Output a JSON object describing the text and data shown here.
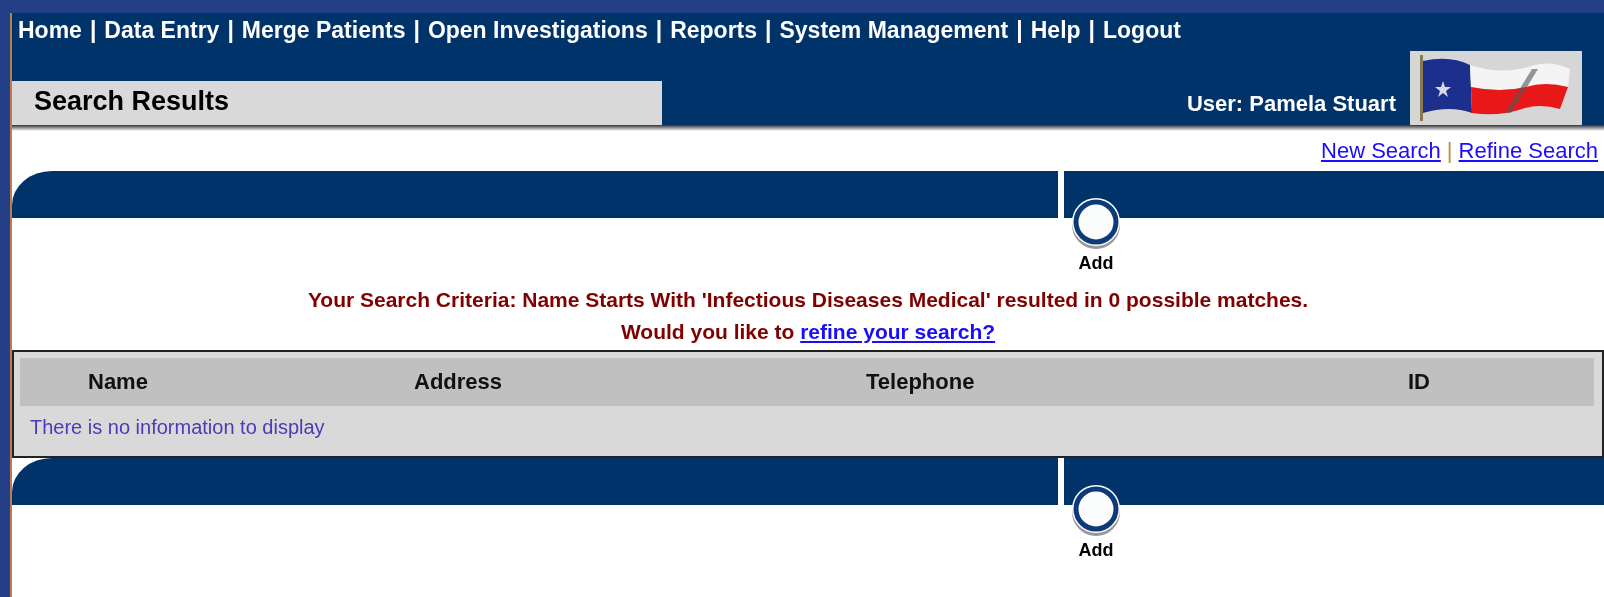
{
  "nav": [
    {
      "label": "Home",
      "separator": "|"
    },
    {
      "label": "Data Entry",
      "separator": "|"
    },
    {
      "label": "Merge Patients",
      "separator": "|"
    },
    {
      "label": "Open Investigations",
      "separator": "|"
    },
    {
      "label": "Reports",
      "separator": "|"
    },
    {
      "label": "System Management",
      "separator": "|"
    },
    {
      "label": "Help",
      "separator": "|"
    },
    {
      "label": "Logout"
    }
  ],
  "page_title": "Search Results",
  "user": "User: Pamela Stuart",
  "links": [
    {
      "label": "New Search",
      "separator": "|"
    },
    {
      "label": "Refine Search"
    }
  ],
  "panels": [
    {
      "button": "Add"
    },
    {
      "button": "Add"
    }
  ],
  "criteria": {
    "summary": "Your Search Criteria: Name Starts With 'Infectious Diseases Medical' resulted in 0 possible matches.",
    "prompt": "Would you like to",
    "prompt_link": "refine your search?"
  },
  "table": {
    "columns": [
      "Name",
      "Address",
      "Telephone",
      "ID"
    ],
    "empty_message": "There is no information to display"
  }
}
